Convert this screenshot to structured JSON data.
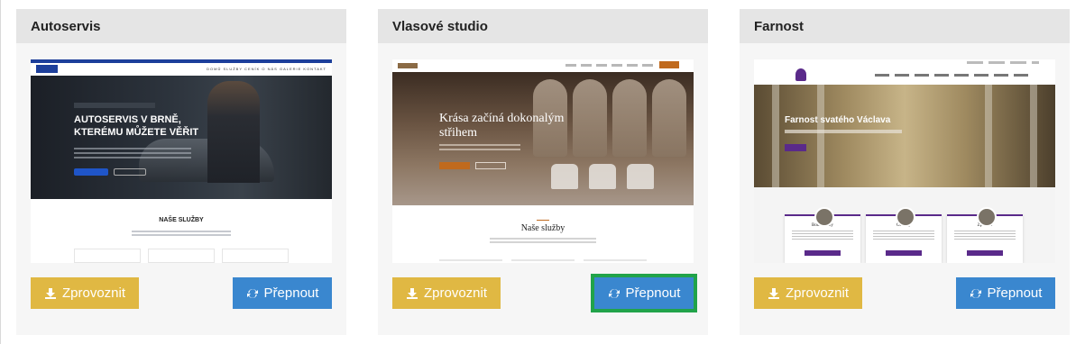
{
  "cards": [
    {
      "title": "Autoservis",
      "activate_label": "Zprovoznit",
      "switch_label": "Přepnout",
      "preview": {
        "nav_links": "DOMŮ  SLUŽBY  CENÍK  O NÁS  GALERIE  KONTAKT",
        "hero_heading": "AUTOSERVIS V BRNĚ, KTERÉMU MŮŽETE VĚŘIT",
        "section_title": "NAŠE SLUŽBY"
      }
    },
    {
      "title": "Vlasové studio",
      "activate_label": "Zprovoznit",
      "switch_label": "Přepnout",
      "preview": {
        "hero_heading": "Krása začíná dokonalým střihem",
        "section_title": "Naše služby"
      }
    },
    {
      "title": "Farnost",
      "activate_label": "Zprovoznit",
      "switch_label": "Přepnout",
      "preview": {
        "hero_heading": "Farnost svatého Václava",
        "cards": [
          "Bohoslužby",
          "Oblátky",
          "Zpovědi"
        ]
      }
    }
  ],
  "colors": {
    "activate_button": "#e0b843",
    "switch_button": "#3a87cf",
    "selected_outline": "#21a34a"
  },
  "icons": {
    "activate": "download-icon",
    "switch": "refresh-icon"
  }
}
